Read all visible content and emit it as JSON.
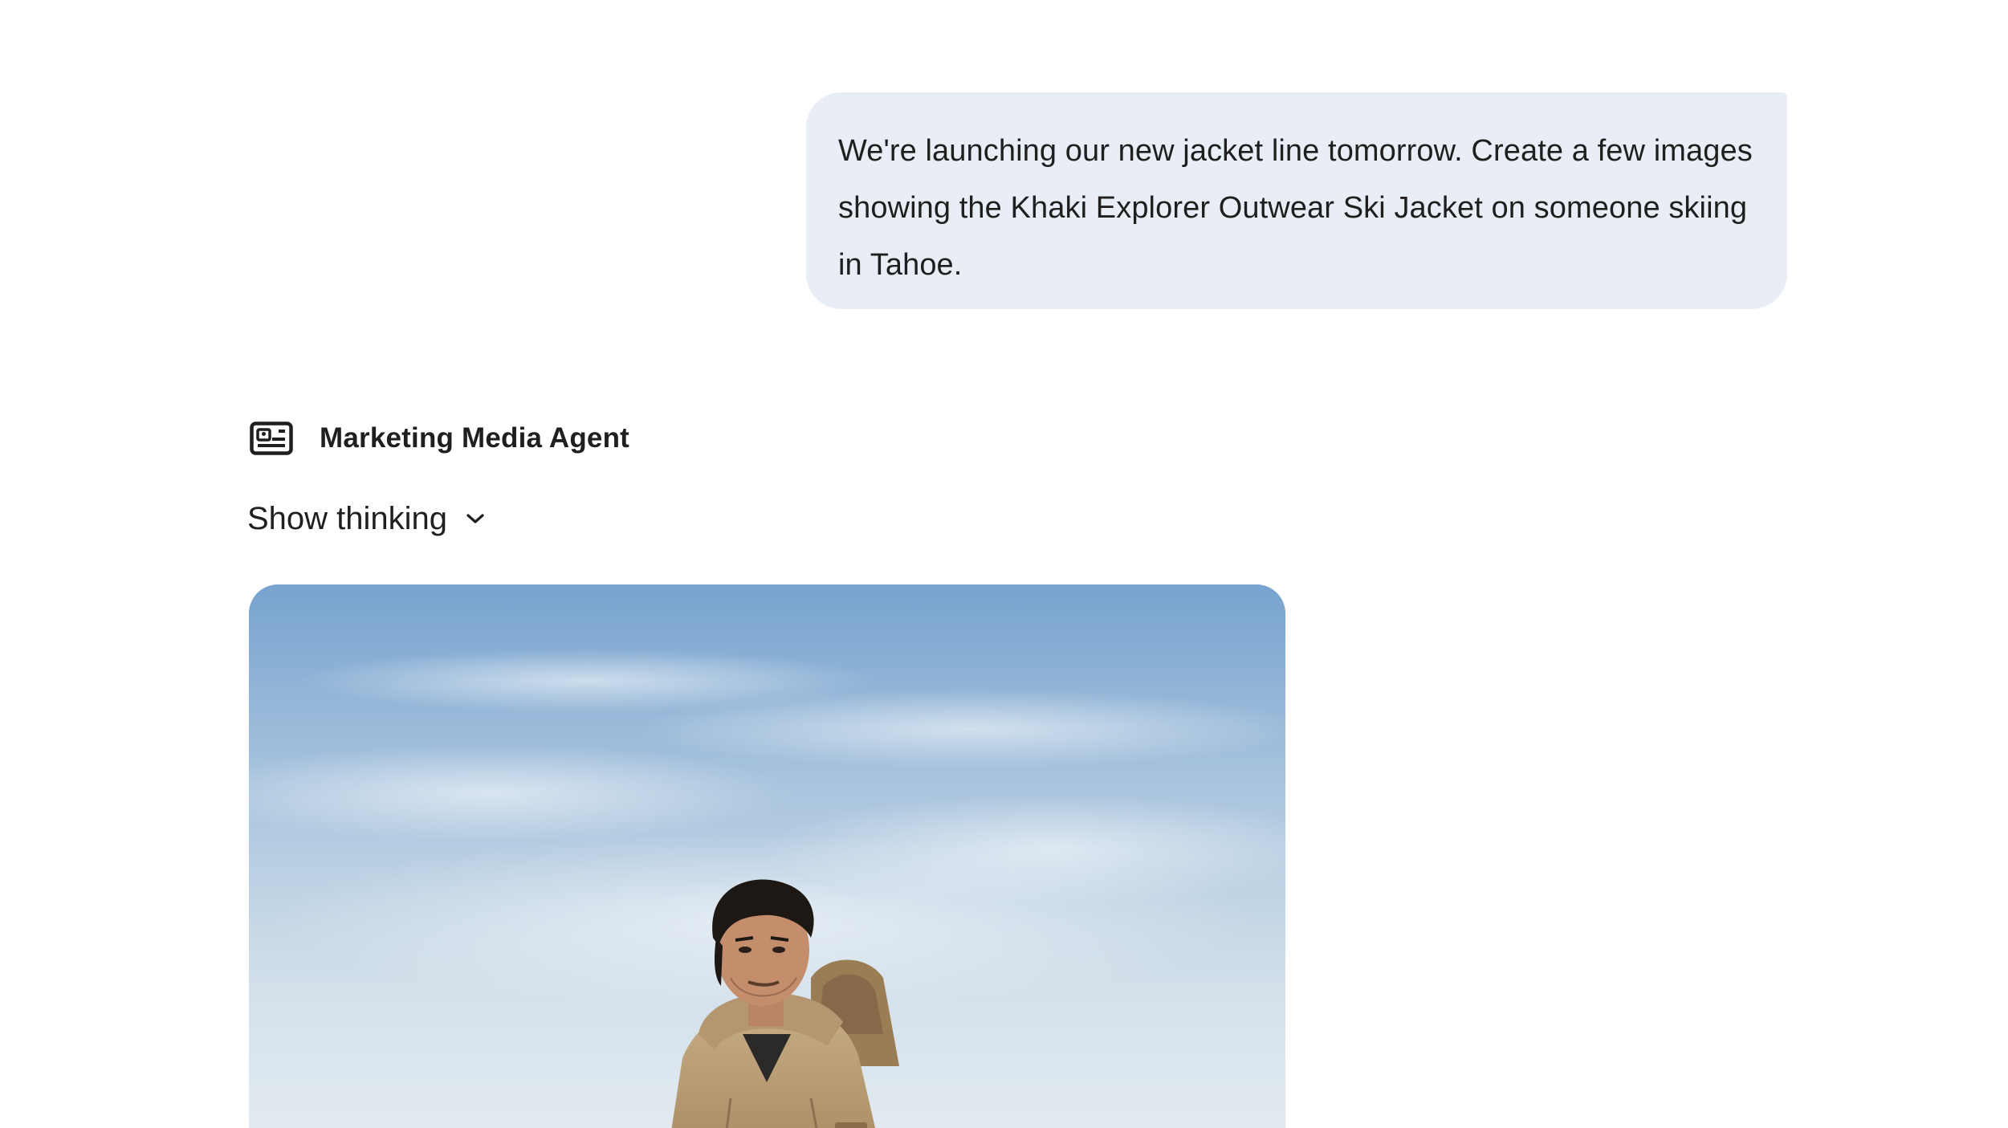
{
  "conversation": {
    "user_message": "We're launching our new jacket line tomorrow. Create a few images showing the Khaki Explorer Outwear Ski Jacket on someone skiing in Tahoe.",
    "agent": {
      "name": "Marketing Media Agent",
      "icon": "agent-card-icon"
    },
    "thinking_toggle": {
      "label": "Show thinking",
      "icon": "chevron-down-icon"
    },
    "generated_image": {
      "subject": "man in khaki ski jacket with backpack against blue sky"
    }
  },
  "colors": {
    "bubble_bg": "#e9eef6",
    "text": "#1f1f1f",
    "sky_top": "#7fa9d3",
    "sky_bottom": "#dfe8ef",
    "jacket": "#b79b74"
  }
}
